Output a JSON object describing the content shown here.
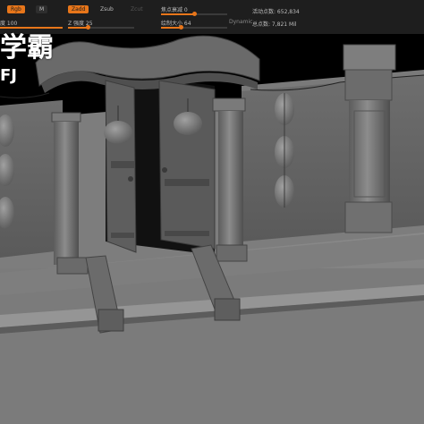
{
  "toolbar": {
    "rgb_label": "Rgb",
    "m_label": "M",
    "zadd_label": "Zadd",
    "zsub_label": "Zsub",
    "zcut_label": "Zcut",
    "focal_shift_label": "焦点衰减 0",
    "draw_size_label": "绘制大小 64",
    "dynamic_label": "Dynamic",
    "intensity_label": "度 100",
    "z_intensity_label": "Z 强度 25",
    "active_points_label": "活动点数: 652,834",
    "total_points_label": "总点数: 7,821 Mil"
  },
  "watermark": {
    "title": "学霸",
    "sub": "FJ"
  },
  "colors": {
    "toolbar_bg": "#1e1e1e",
    "accent": "#e8761a",
    "model_gray": "#7c7c7c",
    "background": "#000000"
  }
}
